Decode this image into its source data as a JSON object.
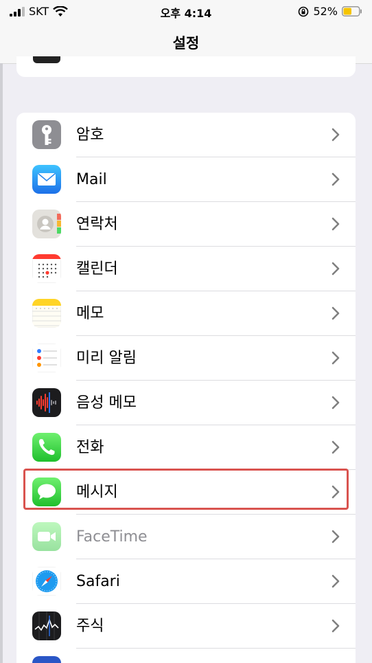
{
  "status_bar": {
    "carrier": "SKT",
    "time": "오후 4:14",
    "battery": "52%"
  },
  "nav": {
    "title": "설정"
  },
  "settings": {
    "items": [
      {
        "label": "암호",
        "icon": "key-icon"
      },
      {
        "label": "Mail",
        "icon": "mail-icon"
      },
      {
        "label": "연락처",
        "icon": "contacts-icon"
      },
      {
        "label": "캘린더",
        "icon": "calendar-icon"
      },
      {
        "label": "메모",
        "icon": "notes-icon"
      },
      {
        "label": "미리 알림",
        "icon": "reminders-icon"
      },
      {
        "label": "음성 메모",
        "icon": "voice-memos-icon"
      },
      {
        "label": "전화",
        "icon": "phone-icon"
      },
      {
        "label": "메시지",
        "icon": "messages-icon"
      },
      {
        "label": "FaceTime",
        "icon": "facetime-icon"
      },
      {
        "label": "Safari",
        "icon": "safari-icon"
      },
      {
        "label": "주식",
        "icon": "stocks-icon"
      }
    ]
  },
  "colors": {
    "highlight": "#d9534f",
    "separator": "#dcdce0",
    "background": "#efeef4"
  }
}
